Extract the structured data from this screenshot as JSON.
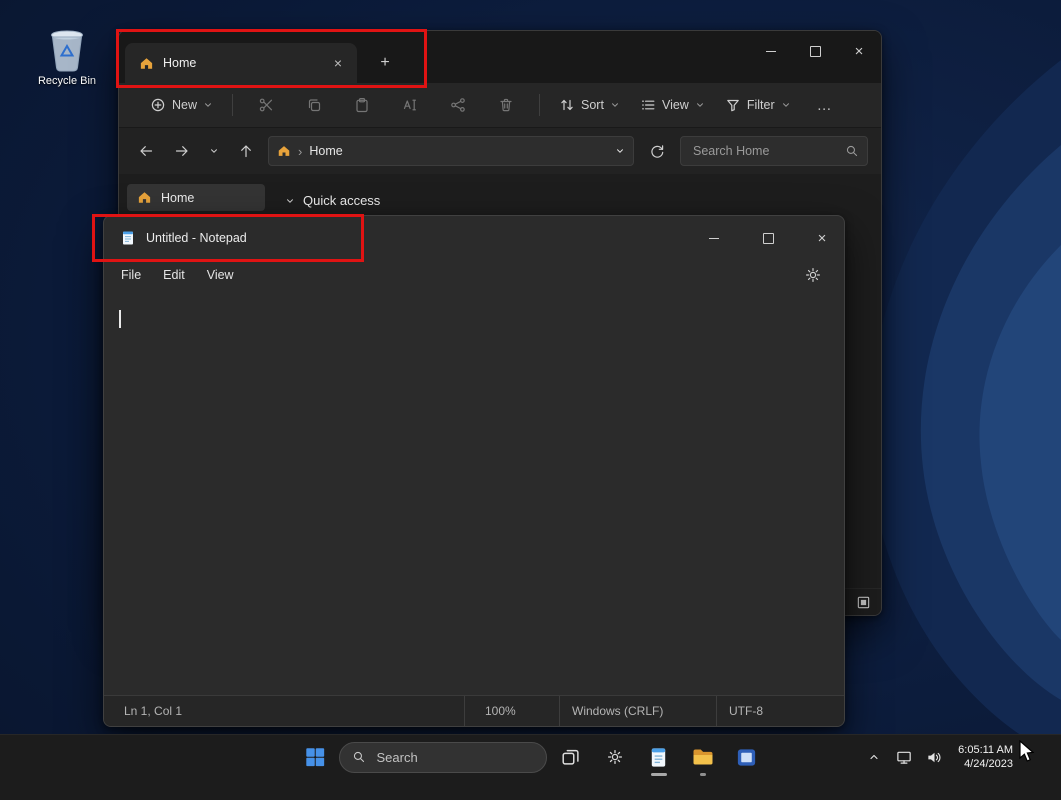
{
  "desktop": {
    "recycle_bin_label": "Recycle Bin"
  },
  "file_explorer": {
    "tab_label": "Home",
    "toolbar": {
      "new": "New",
      "sort": "Sort",
      "view": "View",
      "filter": "Filter"
    },
    "address_location": "Home",
    "search_placeholder": "Search Home",
    "sidebar_home": "Home",
    "quick_access": "Quick access"
  },
  "notepad": {
    "title": "Untitled - Notepad",
    "menus": [
      "File",
      "Edit",
      "View"
    ],
    "status": {
      "cursor_position": "Ln 1, Col 1",
      "zoom": "100%",
      "line_ending": "Windows (CRLF)",
      "encoding": "UTF-8"
    }
  },
  "taskbar": {
    "search_placeholder": "Search",
    "clock": {
      "time": "6:05:11 AM",
      "date": "4/24/2023"
    }
  },
  "icons": {
    "close": "×",
    "plus": "+",
    "more": "…",
    "breadcrumb_separator": "›"
  },
  "colors": {
    "highlight_red": "#e01313",
    "accent_blue": "#4691e8",
    "home_orange": "#e8a33b",
    "folder_yellow": "#f3c14b",
    "notepad_blue": "#4ba0e8"
  }
}
